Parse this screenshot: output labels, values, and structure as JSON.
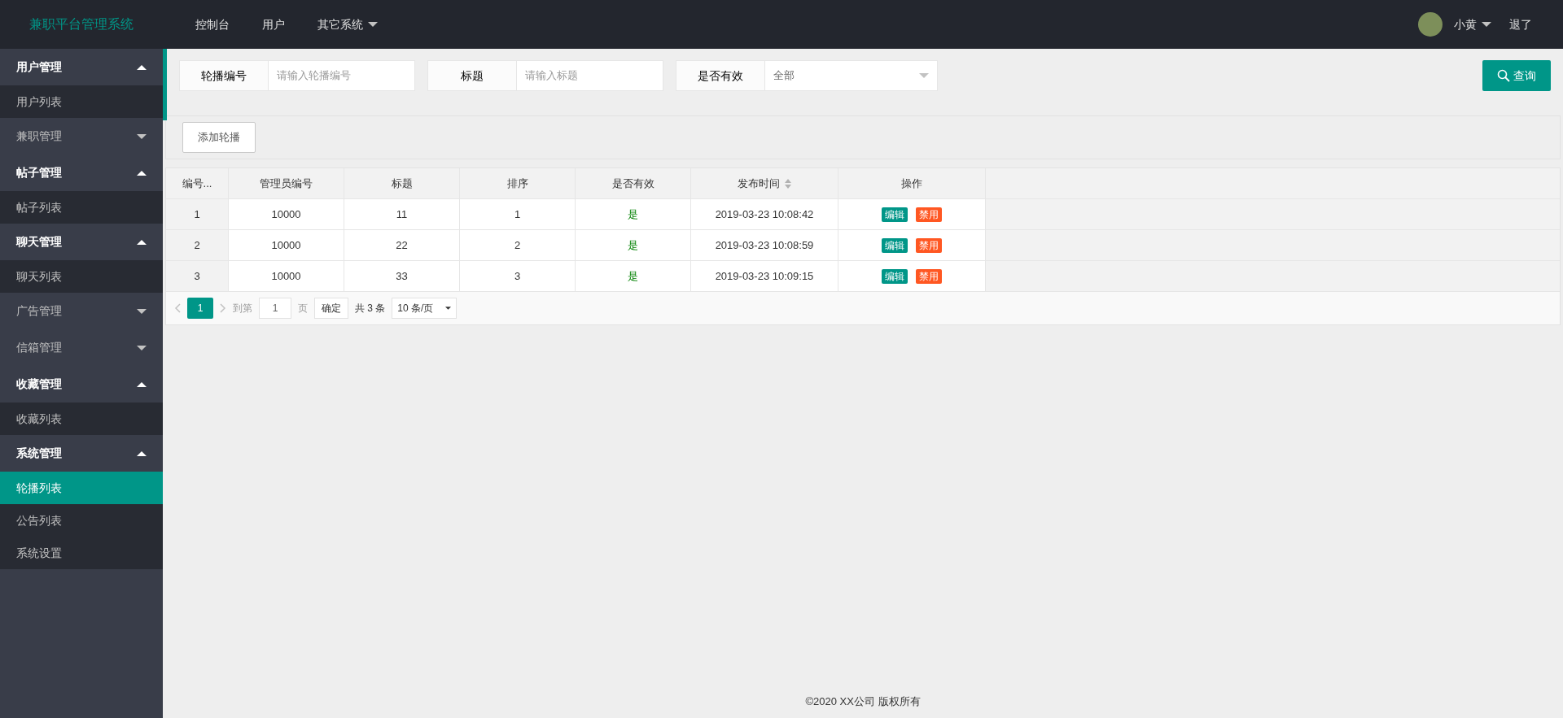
{
  "header": {
    "logo": "兼职平台管理系统",
    "nav": [
      {
        "label": "控制台",
        "dropdown": false
      },
      {
        "label": "用户",
        "dropdown": false
      },
      {
        "label": "其它系统",
        "dropdown": true
      }
    ],
    "user": {
      "name": "小黄"
    },
    "logout": "退了"
  },
  "sidebar": {
    "groups": [
      {
        "label": "用户管理",
        "expanded": true,
        "children": [
          {
            "label": "用户列表",
            "selected": false
          }
        ]
      },
      {
        "label": "兼职管理",
        "expanded": false
      },
      {
        "label": "帖子管理",
        "expanded": true,
        "children": [
          {
            "label": "帖子列表",
            "selected": false
          }
        ]
      },
      {
        "label": "聊天管理",
        "expanded": true,
        "children": [
          {
            "label": "聊天列表",
            "selected": false
          }
        ]
      },
      {
        "label": "广告管理",
        "expanded": false
      },
      {
        "label": "信箱管理",
        "expanded": false
      },
      {
        "label": "收藏管理",
        "expanded": true,
        "children": [
          {
            "label": "收藏列表",
            "selected": false
          }
        ]
      },
      {
        "label": "系统管理",
        "expanded": true,
        "children": [
          {
            "label": "轮播列表",
            "selected": true
          },
          {
            "label": "公告列表",
            "selected": false
          },
          {
            "label": "系统设置",
            "selected": false
          }
        ]
      }
    ]
  },
  "filters": [
    {
      "kind": "input",
      "label": "轮播编号",
      "placeholder": "请输入轮播编号"
    },
    {
      "kind": "input",
      "label": "标题",
      "placeholder": "请输入标题"
    },
    {
      "kind": "select",
      "label": "是否有效",
      "value": "全部"
    }
  ],
  "search_button": "查询",
  "add_button": "添加轮播",
  "table": {
    "columns": [
      {
        "label": "编号...",
        "sortable": false
      },
      {
        "label": "管理员编号",
        "sortable": false
      },
      {
        "label": "标题",
        "sortable": false
      },
      {
        "label": "排序",
        "sortable": false
      },
      {
        "label": "是否有效",
        "sortable": false
      },
      {
        "label": "发布时间",
        "sortable": true
      },
      {
        "label": "操作",
        "sortable": false
      }
    ],
    "rows": [
      {
        "id": "1",
        "admin": "10000",
        "title": "11",
        "order": "1",
        "valid": "是",
        "time": "2019-03-23 10:08:42",
        "actions": [
          "编辑",
          "禁用"
        ]
      },
      {
        "id": "2",
        "admin": "10000",
        "title": "22",
        "order": "2",
        "valid": "是",
        "time": "2019-03-23 10:08:59",
        "actions": [
          "编辑",
          "禁用"
        ]
      },
      {
        "id": "3",
        "admin": "10000",
        "title": "33",
        "order": "3",
        "valid": "是",
        "time": "2019-03-23 10:09:15",
        "actions": [
          "编辑",
          "禁用"
        ]
      }
    ]
  },
  "pagination": {
    "pages": [
      {
        "label": "1",
        "selected": true
      }
    ],
    "goto_label": "到第",
    "goto_value": "1",
    "page_unit": "页",
    "confirm": "确定",
    "total": "共 3 条",
    "page_size": "10 条/页"
  },
  "footer": "©2020 XX公司 版权所有"
}
